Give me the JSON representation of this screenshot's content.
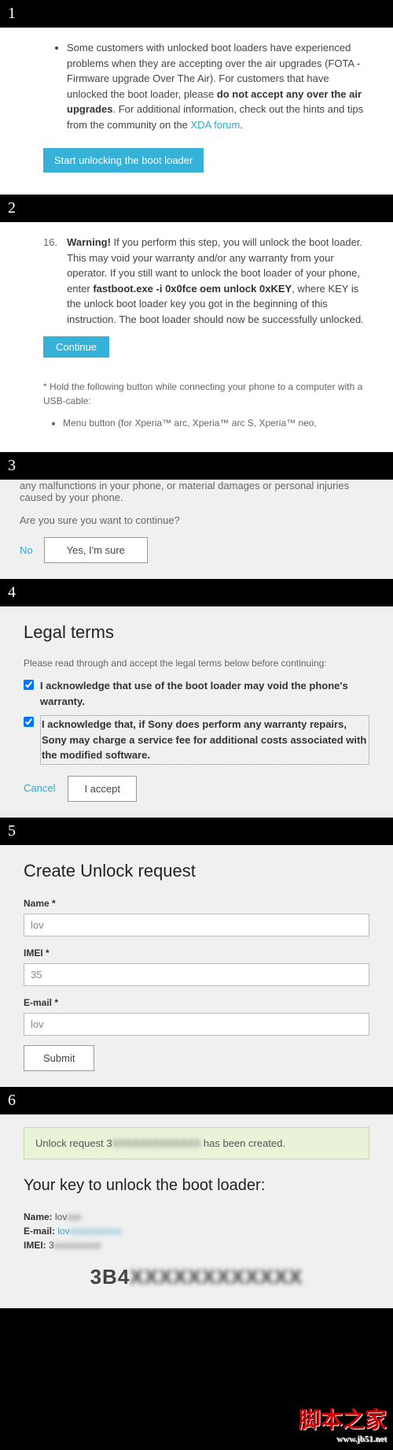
{
  "step1": {
    "num": "1",
    "bullet_pre": "Some customers with unlocked boot loaders have experienced problems when they are accepting over the air upgrades (FOTA - Firmware upgrade Over The Air). For customers that have unlocked the boot loader, please ",
    "bullet_bold": "do not accept any over the air upgrades",
    "bullet_post": ". For additional information, check out the hints and tips from the community on the ",
    "bullet_link": "XDA forum",
    "bullet_end": ".",
    "button": "Start unlocking the boot loader"
  },
  "step2": {
    "num": "2",
    "item_num": "16.",
    "warn": "Warning!",
    "text1": " If you perform this step, you will unlock the boot loader. This may void your warranty and/or any warranty from your operator. If you still want to unlock the boot loader of your phone, enter ",
    "cmd": "fastboot.exe -i 0x0fce oem unlock 0xKEY",
    "text2": ", where KEY is the unlock boot loader key you got in the beginning of this instruction. The boot loader should now be successfully unlocked.",
    "continue": "Continue",
    "note": "* Hold the following button while connecting your phone to a computer with a USB-cable:",
    "note_li": "Menu button (for Xperia™ arc, Xperia™ arc S, Xperia™ neo,"
  },
  "step3": {
    "num": "3",
    "text": "any malfunctions in your phone, or material damages or personal injuries caused by your phone.",
    "question": "Are you sure you want to continue?",
    "no": "No",
    "yes": "Yes, I'm sure"
  },
  "step4": {
    "num": "4",
    "title": "Legal terms",
    "intro": "Please read through and accept the legal terms below before continuing:",
    "check1": "I acknowledge that use of the boot loader may void the phone's warranty.",
    "check2": "I acknowledge that, if Sony does perform any warranty repairs, Sony may charge a service fee for additional costs associated with the modified software.",
    "cancel": "Cancel",
    "accept": "I accept"
  },
  "step5": {
    "num": "5",
    "title": "Create Unlock request",
    "name_label": "Name *",
    "name_val": "lov",
    "imei_label": "IMEI *",
    "imei_val": "35",
    "email_label": "E-mail *",
    "email_val": "lov",
    "submit": "Submit"
  },
  "step6": {
    "num": "6",
    "success_pre": "Unlock request 3",
    "success_post": " has been created.",
    "title": "Your key to unlock the boot loader:",
    "name_lbl": "Name: ",
    "name_val": "lov",
    "email_lbl": "E-mail: ",
    "email_val": "lov",
    "imei_lbl": "IMEI: ",
    "imei_val": "3",
    "key": "3B4"
  },
  "watermark": {
    "main": "脚本之家",
    "sub": "www.jb51.net"
  }
}
